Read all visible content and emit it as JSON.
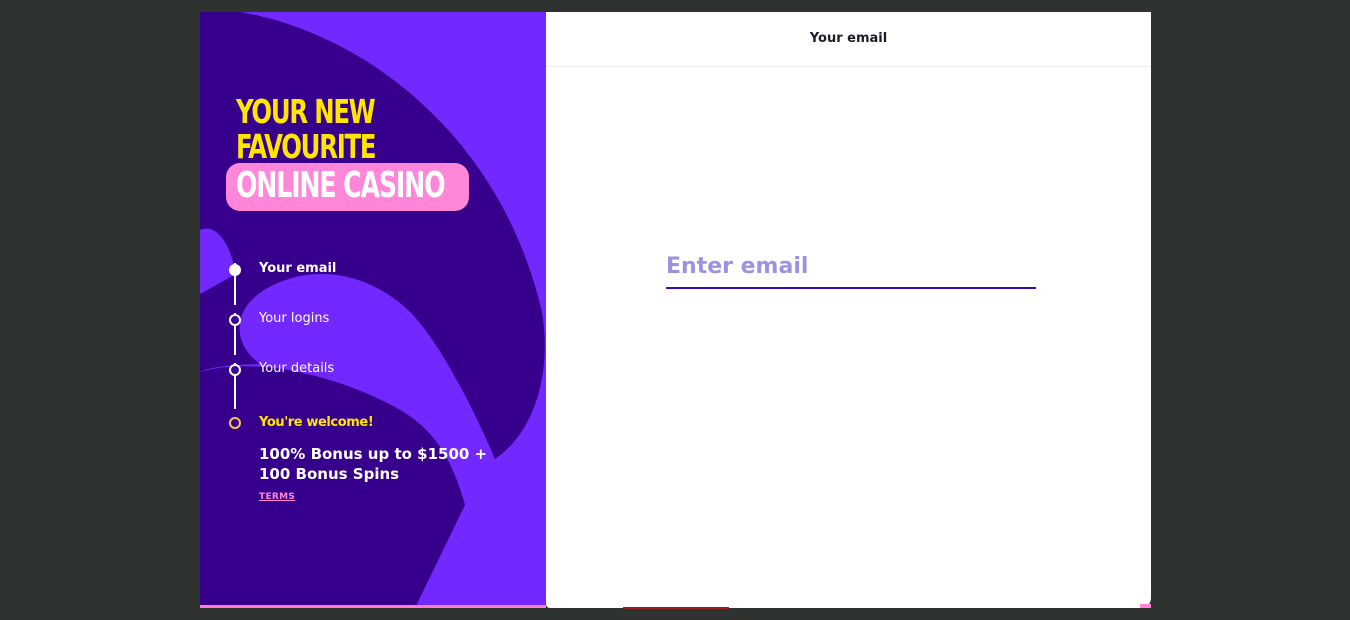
{
  "hero": {
    "line1": "YOUR NEW",
    "line2": "FAVOURITE",
    "line3": "ONLINE CASINO"
  },
  "steps": [
    {
      "label": "Your email",
      "state": "active"
    },
    {
      "label": "Your logins",
      "state": "pending"
    },
    {
      "label": "Your details",
      "state": "pending"
    },
    {
      "label": "You're welcome!",
      "state": "final"
    }
  ],
  "bonus": {
    "text": "100% Bonus up to $1500 + 100 Bonus Spins",
    "terms_label": "TERMS"
  },
  "form": {
    "header_title": "Your email",
    "email_placeholder": "Enter email",
    "email_value": ""
  },
  "colors": {
    "panel_purple": "#7328ff",
    "panel_dark": "#36008c",
    "accent_yellow": "#ffe600",
    "accent_pink": "#ff86d8",
    "input_underline": "#3a0ab8"
  }
}
